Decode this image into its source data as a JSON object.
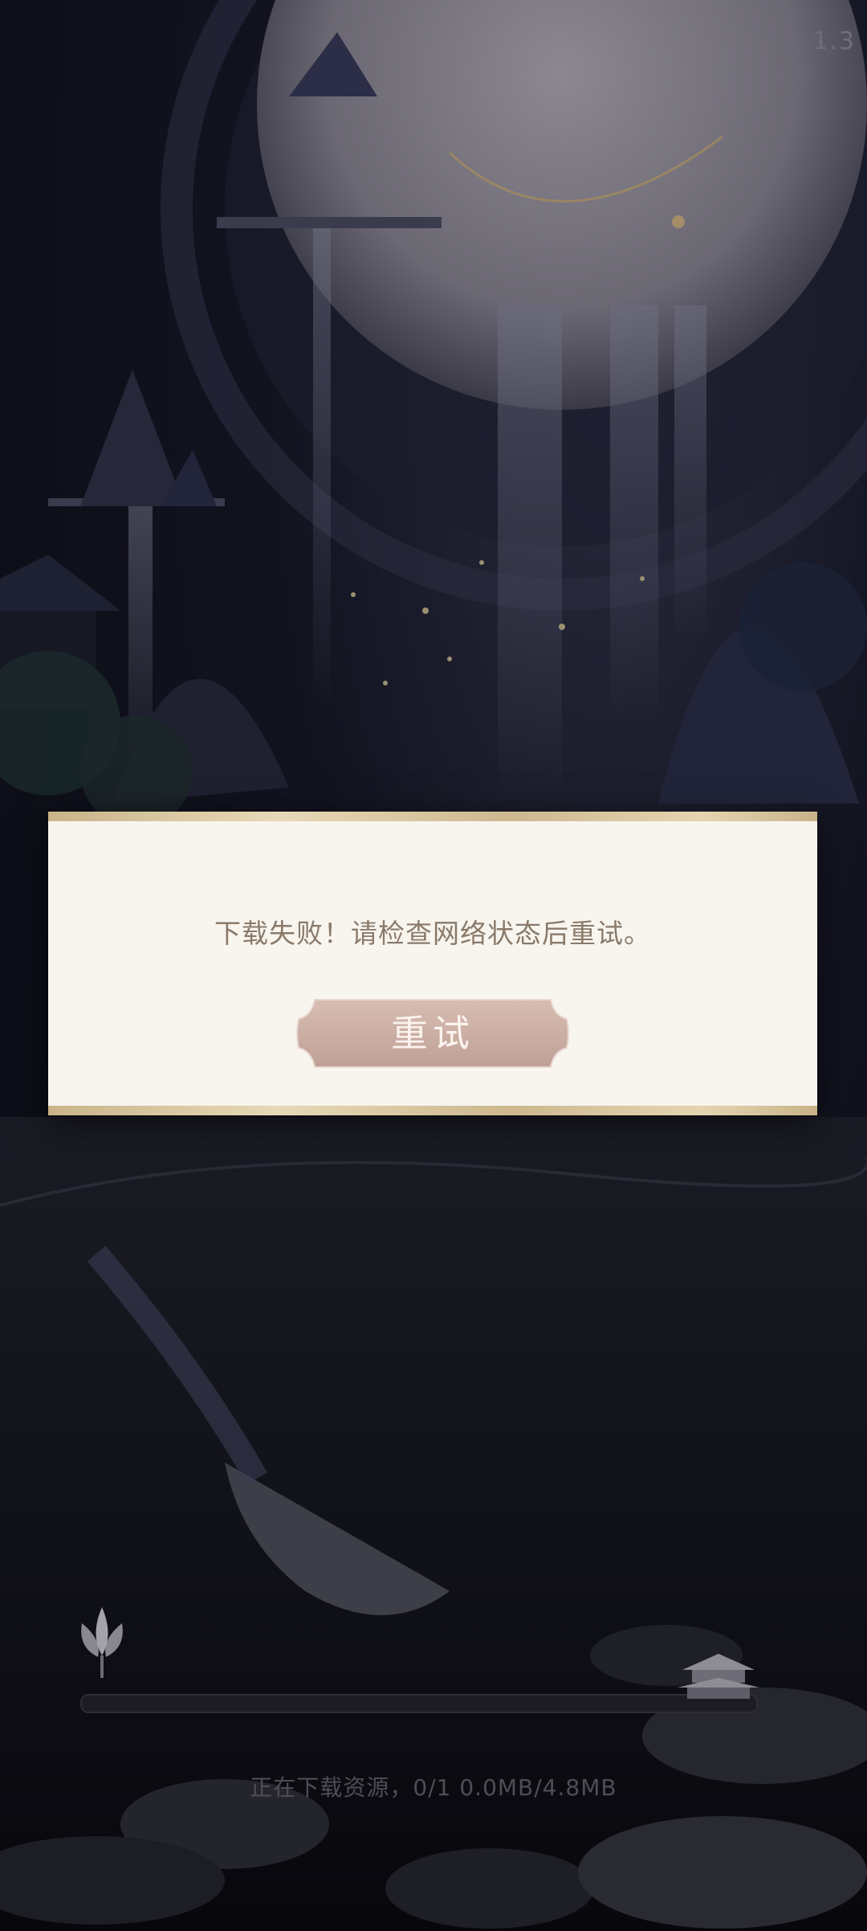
{
  "corner": {
    "text": "1.3"
  },
  "dialog": {
    "message": "下载失败！请检查网络状态后重试。",
    "retry_label": "重试"
  },
  "download": {
    "progress": 0.0,
    "status_text": "正在下载资源，0/1  0.0MB/4.8MB"
  },
  "colors": {
    "dialog_bg": "#f8f5ef",
    "dialog_border": "#d8c7a1",
    "message": "#8a7a6a",
    "retry_button": "#c8aca3",
    "status_text": "#4e4d55"
  },
  "icons": [
    "lotus-icon",
    "pagoda-icon"
  ]
}
